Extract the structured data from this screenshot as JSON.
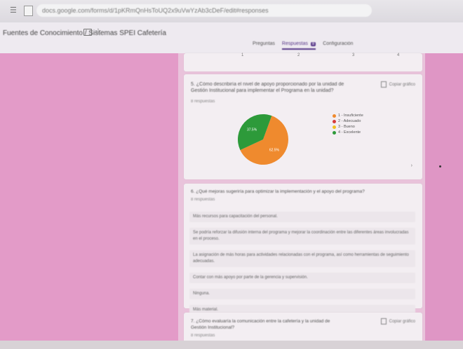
{
  "browser": {
    "url": "docs.google.com/forms/d/1pKRmQnHsToUQ2x9uVwYzAb3cDeF/edit#responses"
  },
  "form": {
    "title": "Fuentes de Conocimiento / Sistemas SPEI Cafetería",
    "tabs": [
      "Preguntas",
      "Respuestas",
      "Configuración"
    ],
    "active_tab_index": 1,
    "response_badge": "8",
    "axis_ticks": [
      "1",
      "2",
      "3",
      "4"
    ]
  },
  "question5": {
    "title": "5. ¿Cómo describiría el nivel de apoyo proporcionado por la unidad de Gestión Institucional para implementar el Programa en la unidad?",
    "count": "8 respuestas",
    "copy_label": "Copiar gráfico",
    "next_label": "›"
  },
  "chart_data": {
    "type": "pie",
    "labels": [
      "1 - Insuficiente",
      "2 - Adecuado",
      "3 - Bueno",
      "4 - Excelente"
    ],
    "values": [
      62.5,
      0,
      0,
      37.5
    ],
    "slice_labels": [
      "62.5%",
      "",
      "",
      "37.5%"
    ],
    "colors": [
      "#ef8a2e",
      "#d63b3b",
      "#f0c020",
      "#2d9a3a"
    ]
  },
  "question6": {
    "title": "6. ¿Qué mejoras sugeriría para optimizar la implementación y el apoyo del programa?",
    "count": "8 respuestas",
    "answers": [
      "Más recursos para capacitación del personal.",
      "Se podría reforzar la difusión interna del programa y mejorar la coordinación entre las diferentes áreas involucradas en el proceso.",
      "La asignación de más horas para actividades relacionadas con el programa, así como herramientas de seguimiento adecuadas.",
      "Contar con más apoyo por parte de la gerencia y supervisión.",
      "Ninguna.",
      "Más material."
    ]
  },
  "question7": {
    "title": "7. ¿Cómo evaluaría la comunicación entre la cafetería y la unidad de Gestión Institucional?",
    "count": "8 respuestas",
    "copy_label": "Copiar gráfico"
  }
}
